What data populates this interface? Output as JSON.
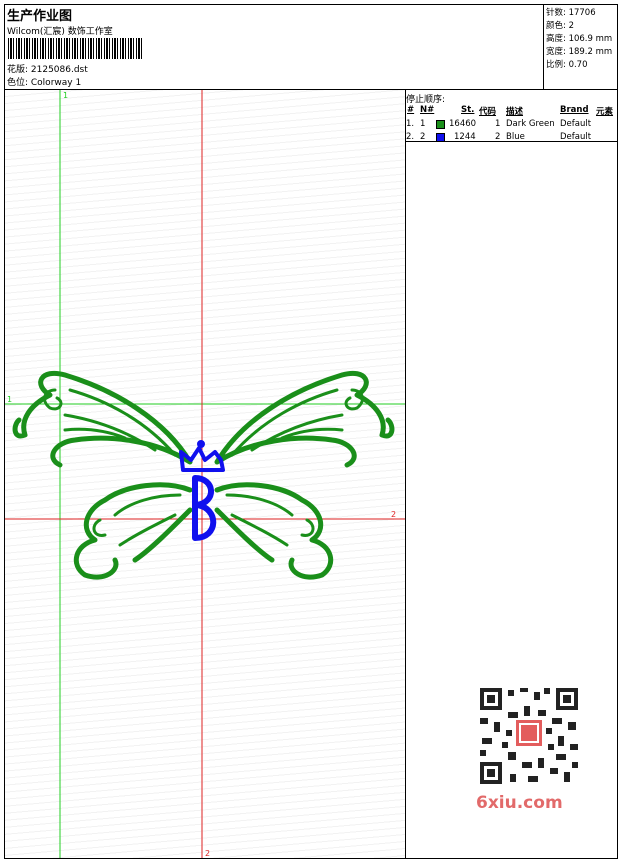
{
  "header": {
    "title": "生产作业图",
    "company": "Wilcom(汇宸) 数饰工作室",
    "design_file": "花版: 2125086.dst",
    "colorway": "色位: Colorway 1"
  },
  "stats": {
    "stitches": "针数: 17706",
    "colors": "颜色: 2",
    "height": "高度: 106.9 mm",
    "width": "宽度: 189.2 mm",
    "scale": "比例: 0.70"
  },
  "stop_sequence": {
    "title": "停止顺序:",
    "columns": [
      "#",
      "N#",
      "St.",
      "代码",
      "描述",
      "Brand",
      "元素"
    ],
    "rows": [
      {
        "index": "1.",
        "n": "1",
        "color": "#1a8f1a",
        "stitches": "16460",
        "code": "1",
        "description": "Dark Green",
        "brand": "Default"
      },
      {
        "index": "2.",
        "n": "2",
        "color": "#1010ee",
        "stitches": "1244",
        "code": "2",
        "description": "Blue",
        "brand": "Default"
      }
    ]
  },
  "guides": {
    "green_v_label": "1",
    "green_h_label": "1",
    "red_v_label": "2",
    "red_h_label": "2"
  },
  "colors": {
    "thread_green": "#1a8f1a",
    "thread_blue": "#1010ee",
    "guide_green": "#22cc22",
    "guide_red": "#dd2222"
  },
  "watermark": "6xiu.com"
}
